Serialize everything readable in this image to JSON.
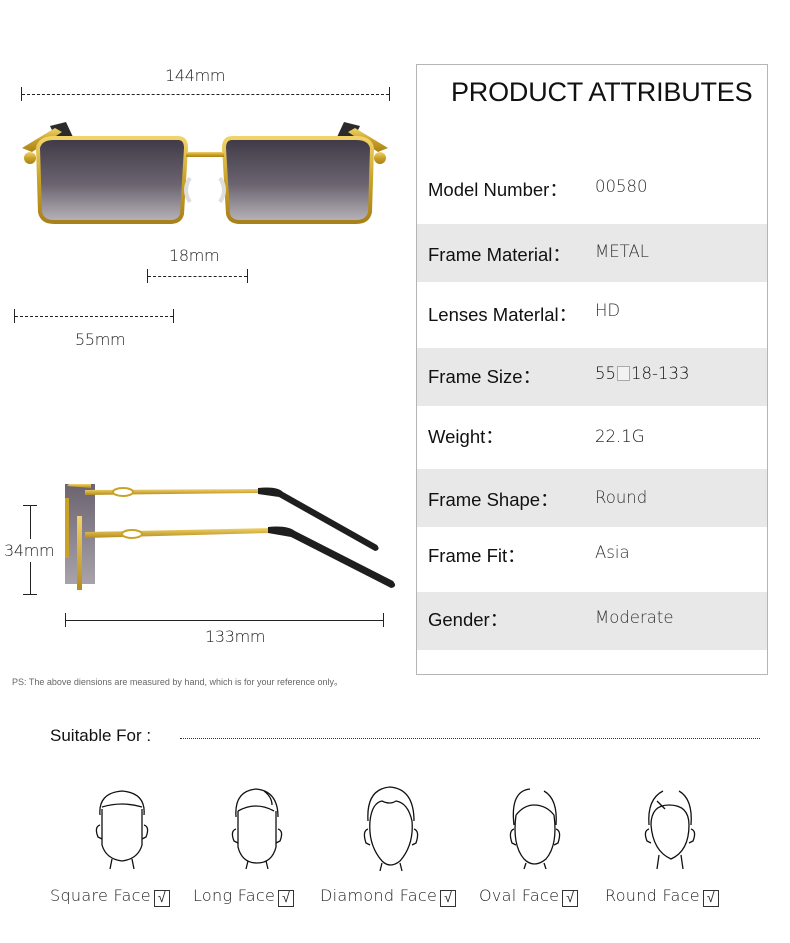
{
  "dimensions": {
    "total_width": "144mm",
    "bridge": "18mm",
    "lens_width": "55mm",
    "lens_height": "34mm",
    "temple_length": "133mm",
    "note": "PS:  The above diensions are measured by hand, which is for your reference only。"
  },
  "attributes": {
    "title": "PRODUCT ATTRIBUTES",
    "rows": [
      {
        "label": "Model Number：",
        "value": "00580"
      },
      {
        "label": "Frame Material：",
        "value": "METAL"
      },
      {
        "label": "Lenses Materlal：",
        "value": "HD"
      },
      {
        "label": "Frame Size：",
        "value_prefix": "55",
        "value_suffix": "18-133"
      },
      {
        "label": "Weight：",
        "value": "22.1G"
      },
      {
        "label": "Frame Shape：",
        "value": "Round"
      },
      {
        "label": "Frame Fit：",
        "value": "Asia"
      },
      {
        "label": "Gender：",
        "value": "Moderate"
      }
    ]
  },
  "suitable": {
    "title": "Suitable For :",
    "check_mark": "√",
    "faces": [
      {
        "label": "Square Face",
        "icon": "square-face-icon",
        "checked": true
      },
      {
        "label": "Long Face",
        "icon": "long-face-icon",
        "checked": true
      },
      {
        "label": "Diamond Face",
        "icon": "diamond-face-icon",
        "checked": true
      },
      {
        "label": "Oval Face",
        "icon": "oval-face-icon",
        "checked": true
      },
      {
        "label": "Round Face",
        "icon": "round-face-icon",
        "checked": true
      }
    ]
  },
  "colors": {
    "frame_gold": "#c9a227",
    "lens_dark": "#4a4450",
    "row_shade": "#e8e8e8"
  }
}
